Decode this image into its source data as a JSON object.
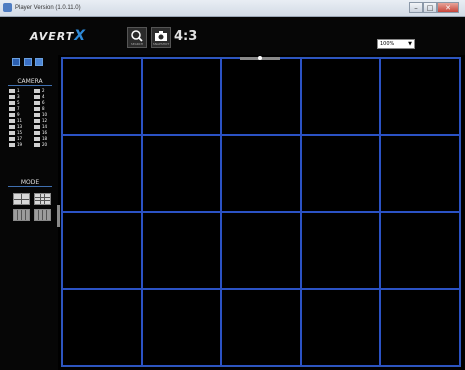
{
  "window": {
    "title": "Player Version (1.0.11.0)",
    "minimize": "–",
    "maximize": "□",
    "close": "✕"
  },
  "toolbar": {
    "logo_text": "AVERT",
    "logo_x": "X",
    "search_caption": "SEARCH",
    "snapshot_caption": "SNAPSHOT",
    "aspect_label": "4:3",
    "zoom_value": "100%",
    "zoom_arrow": "▼"
  },
  "sidebar": {
    "camera_heading": "CAMERA",
    "cameras": [
      "1",
      "2",
      "3",
      "4",
      "5",
      "6",
      "7",
      "8",
      "9",
      "10",
      "11",
      "12",
      "13",
      "14",
      "15",
      "16",
      "17",
      "18",
      "19",
      "20"
    ],
    "mode_heading": "MODE"
  },
  "accent_color": "#2b52c5",
  "grid": {
    "rows": 4,
    "cols": 5
  }
}
